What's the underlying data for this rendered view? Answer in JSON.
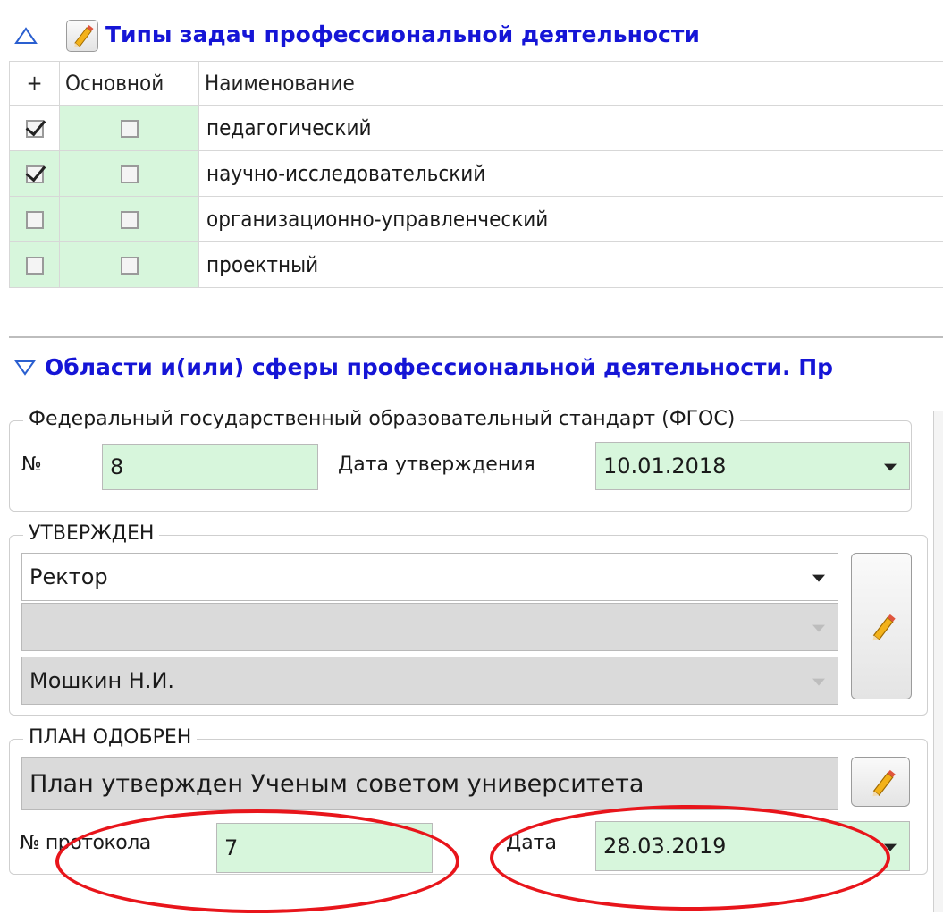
{
  "section1": {
    "title": "Типы задач профессиональной деятельности",
    "table": {
      "headers": [
        "+",
        "Основной",
        "Наименование"
      ],
      "rows": [
        {
          "selected": true,
          "main": false,
          "name": "педагогический"
        },
        {
          "selected": true,
          "main": false,
          "name": "научно-исследовательский"
        },
        {
          "selected": false,
          "main": false,
          "name": "организационно-управленческий"
        },
        {
          "selected": false,
          "main": false,
          "name": "проектный"
        }
      ]
    }
  },
  "section2": {
    "title": "Области и(или) сферы профессиональной деятельности. Пр"
  },
  "fgos": {
    "group_label": "Федеральный государственный образовательный стандарт (ФГОС)",
    "number_label": "№",
    "number_value": "8",
    "date_label": "Дата утверждения",
    "date_value": "10.01.2018"
  },
  "approved": {
    "group_label": "УТВЕРЖДЕН",
    "position_value": "Ректор",
    "second_value": "",
    "person_value": "Мошкин Н.И."
  },
  "plan": {
    "group_label": "ПЛАН ОДОБРЕН",
    "text_value": "План утвержден Ученым советом университета",
    "protocol_label": "№ протокола",
    "protocol_value": "7",
    "date_label": "Дата",
    "date_value": "28.03.2019"
  },
  "colors": {
    "title_blue": "#1515d6",
    "field_green": "#d7f6dc",
    "field_gray": "#dadada",
    "highlight_red": "#e8151b"
  }
}
